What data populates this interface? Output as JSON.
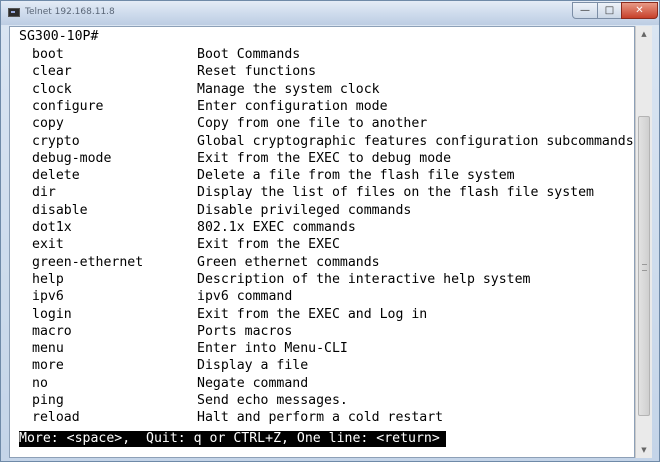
{
  "window": {
    "title": "Telnet 192.168.11.8",
    "icon": "terminal-icon",
    "controls": {
      "minimize": "—",
      "maximize": "□",
      "close": "✕"
    }
  },
  "terminal": {
    "prompt": "SG300-10P#",
    "commands": [
      {
        "name": "boot",
        "desc": "Boot Commands"
      },
      {
        "name": "clear",
        "desc": "Reset functions"
      },
      {
        "name": "clock",
        "desc": "Manage the system clock"
      },
      {
        "name": "configure",
        "desc": "Enter configuration mode"
      },
      {
        "name": "copy",
        "desc": "Copy from one file to another"
      },
      {
        "name": "crypto",
        "desc": "Global cryptographic features configuration subcommands"
      },
      {
        "name": "debug-mode",
        "desc": "Exit from the EXEC to debug mode"
      },
      {
        "name": "delete",
        "desc": "Delete a file from the flash file system"
      },
      {
        "name": "dir",
        "desc": "Display the list of files on the flash file system"
      },
      {
        "name": "disable",
        "desc": "Disable privileged commands"
      },
      {
        "name": "dot1x",
        "desc": "802.1x EXEC commands"
      },
      {
        "name": "exit",
        "desc": "Exit from the EXEC"
      },
      {
        "name": "green-ethernet",
        "desc": "Green ethernet commands"
      },
      {
        "name": "help",
        "desc": "Description of the interactive help system"
      },
      {
        "name": "ipv6",
        "desc": "ipv6 command"
      },
      {
        "name": "login",
        "desc": "Exit from the EXEC and Log in"
      },
      {
        "name": "macro",
        "desc": "Ports macros"
      },
      {
        "name": "menu",
        "desc": "Enter into Menu-CLI"
      },
      {
        "name": "more",
        "desc": "Display a file"
      },
      {
        "name": "no",
        "desc": "Negate command"
      },
      {
        "name": "ping",
        "desc": "Send echo messages."
      },
      {
        "name": "reload",
        "desc": "Halt and perform a cold restart"
      }
    ],
    "more_prompt": "More: <space>,  Quit: q or CTRL+Z, One line: <return>"
  },
  "scrollbar": {
    "up_arrow": "▲",
    "down_arrow": "▼"
  }
}
